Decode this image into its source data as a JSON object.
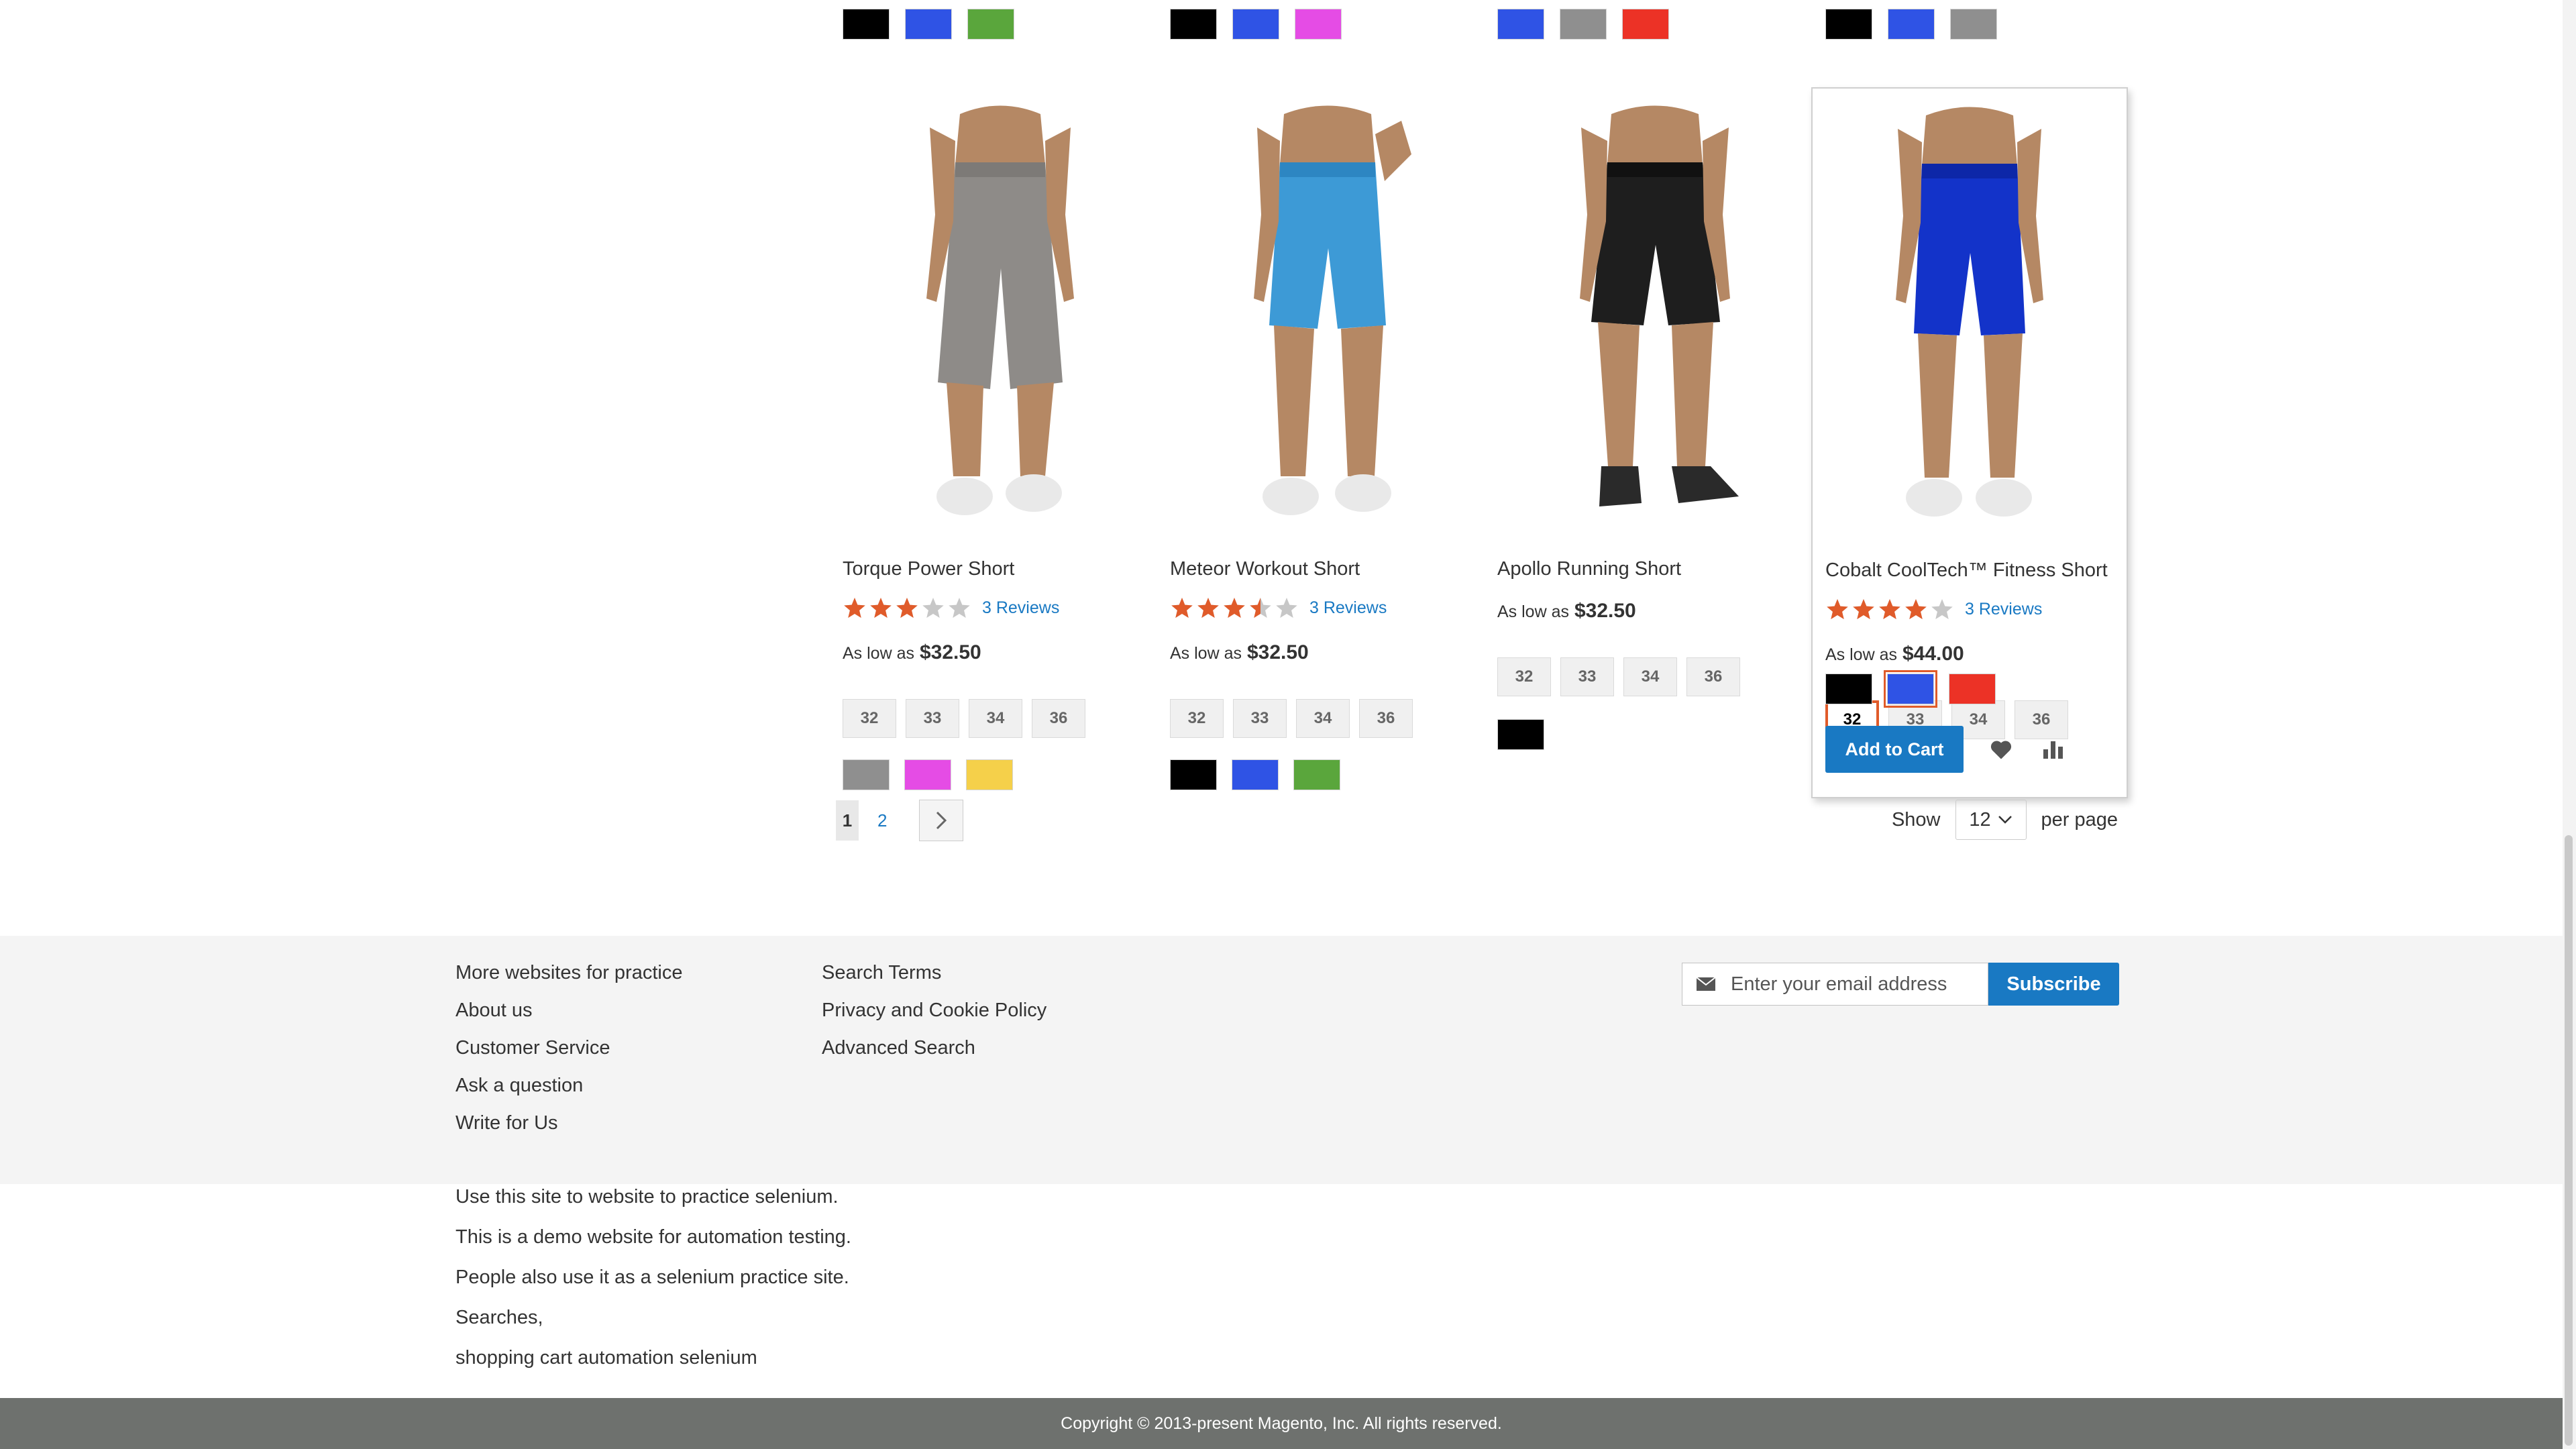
{
  "colors": {
    "black": "#000000",
    "blue": "#2f53e5",
    "green": "#5aa63c",
    "magenta": "#e54ce5",
    "gray": "#8f8f8f",
    "red": "#ec3226",
    "yellow": "#f5d04a",
    "accent": "#1979c3",
    "star": "#e05b2a",
    "star_empty": "#c7c7c7"
  },
  "top_swatches": [
    [
      "black",
      "blue",
      "green"
    ],
    [
      "black",
      "blue",
      "magenta"
    ],
    [
      "blue",
      "gray",
      "red"
    ],
    [
      "black",
      "blue",
      "gray"
    ]
  ],
  "products": [
    {
      "name": "Torque Power Short",
      "rating_stars": 3,
      "reviews": "3 Reviews",
      "price_prefix": "As low as",
      "price": "$32.50",
      "sizes": [
        "32",
        "33",
        "34",
        "36"
      ],
      "colors": [
        "gray",
        "magenta",
        "yellow"
      ]
    },
    {
      "name": "Meteor Workout Short",
      "rating_stars": 3.5,
      "reviews": "3 Reviews",
      "price_prefix": "As low as",
      "price": "$32.50",
      "sizes": [
        "32",
        "33",
        "34",
        "36"
      ],
      "colors": [
        "black",
        "blue",
        "green"
      ]
    },
    {
      "name": "Apollo Running Short",
      "price_prefix": "As low as",
      "price": "$32.50",
      "sizes": [
        "32",
        "33",
        "34",
        "36"
      ],
      "colors": [
        "black"
      ]
    },
    {
      "name": "Cobalt CoolTech™ Fitness Short",
      "rating_stars": 4,
      "reviews": "3 Reviews",
      "price_prefix": "As low as",
      "price": "$44.00",
      "sizes": [
        "32",
        "33",
        "34",
        "36"
      ],
      "selected_size": "32",
      "colors": [
        "black",
        "blue",
        "red"
      ],
      "selected_color": "blue",
      "add_to_cart": "Add to Cart"
    }
  ],
  "pager": {
    "current": "1",
    "pages": [
      "2"
    ]
  },
  "limiter": {
    "show": "Show",
    "value": "12",
    "per_page": "per page"
  },
  "footer": {
    "col1": [
      "More websites for practice",
      "About us",
      "Customer Service",
      "Ask a question",
      "Write for Us"
    ],
    "col2": [
      "Search Terms",
      "Privacy and Cookie Policy",
      "Advanced Search"
    ],
    "newsletter_placeholder": "Enter your email address",
    "subscribe": "Subscribe"
  },
  "seo_lines": [
    "Use this site to website to practice selenium.",
    "This is a demo website for automation testing.",
    "People also use it as a selenium practice site.",
    "Searches,",
    "shopping cart automation selenium"
  ],
  "copyright": "Copyright © 2013-present Magento, Inc. All rights reserved."
}
